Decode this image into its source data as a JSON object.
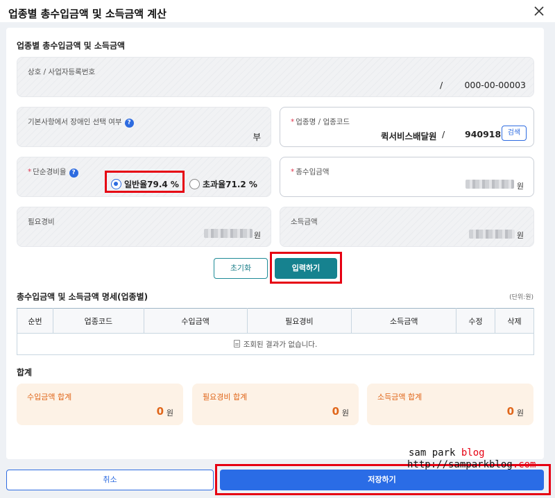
{
  "dialog": {
    "title": "업종별 총수입금액 및 소득금액 계산"
  },
  "form": {
    "section_title": "업종별 총수입금액 및 소득금액",
    "business_label": "상호 / 사업자등록번호",
    "business_sep": "/",
    "business_number": "000-00-00003",
    "disabled_label": "기본사항에서 장애인 선택 여부",
    "disabled_value": "부",
    "industry_label": "업종명 / 업종코드",
    "industry_name": "퀵서비스배달원",
    "industry_sep": "/",
    "industry_code": "940918",
    "search_button": "검색",
    "rate_label": "단순경비율",
    "rate_options": [
      "일반율79.4 %",
      "초과율71.2 %"
    ],
    "rate_selected": 0,
    "total_income_label": "총수입금액",
    "expense_label": "필요경비",
    "income_label": "소득금액",
    "won": "원",
    "required_mark": "*",
    "help_mark": "?"
  },
  "actions": {
    "reset": "초기화",
    "input": "입력하기"
  },
  "detail": {
    "title": "총수입금액 및 소득금액 명세(업종별)",
    "unit": "(단위:원)",
    "columns": [
      "순번",
      "업종코드",
      "수입금액",
      "필요경비",
      "소득금액",
      "수정",
      "삭제"
    ],
    "empty_message": "조회된 결과가 없습니다."
  },
  "summary": {
    "title": "합계",
    "cards": [
      {
        "label": "수입금액 합계",
        "value": "0",
        "unit": "원"
      },
      {
        "label": "필요경비 합계",
        "value": "0",
        "unit": "원"
      },
      {
        "label": "소득금액 합계",
        "value": "0",
        "unit": "원"
      }
    ]
  },
  "footer": {
    "cancel": "취소",
    "save": "저장하기"
  },
  "watermark": {
    "line1_a": "sam park ",
    "line1_b": "blog",
    "line2_a": "http://samparkblog",
    "line2_b": ".com"
  },
  "colors": {
    "accent": "#2a6ce6",
    "teal": "#16828f",
    "orange": "#e0661a",
    "highlight": "#e60012"
  }
}
